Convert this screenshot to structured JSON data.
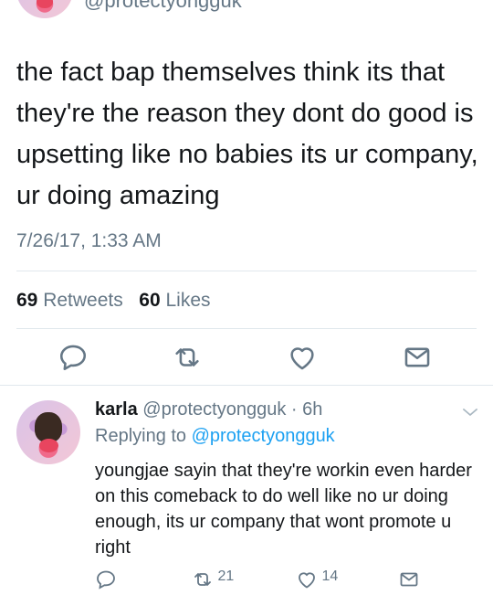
{
  "top_tweet": {
    "handle_partial": "@protectyongguk",
    "text": "the fact bap themselves think its that they're the reason they dont do good is upsetting like no babies its ur company, ur doing amazing",
    "timestamp": "7/26/17, 1:33 AM",
    "retweets_count": "69",
    "retweets_label": "Retweets",
    "likes_count": "60",
    "likes_label": "Likes",
    "actions": [
      "reply-icon",
      "retweet-icon",
      "like-icon",
      "share-icon"
    ]
  },
  "reply": {
    "name": "karla",
    "handle": "@protectyongguk",
    "separator": "·",
    "time": "6h",
    "replying_prefix": "Replying to",
    "replying_to": "@protectyongguk",
    "text": "youngjae sayin that they're workin even harder on this comeback to do well like no ur doing enough, its ur company that wont promote u right",
    "retweet_count": "21",
    "like_count": "14"
  },
  "colors": {
    "text": "#14171a",
    "secondary": "#657786",
    "link": "#1da1f2",
    "divider": "#e1e8ed"
  }
}
